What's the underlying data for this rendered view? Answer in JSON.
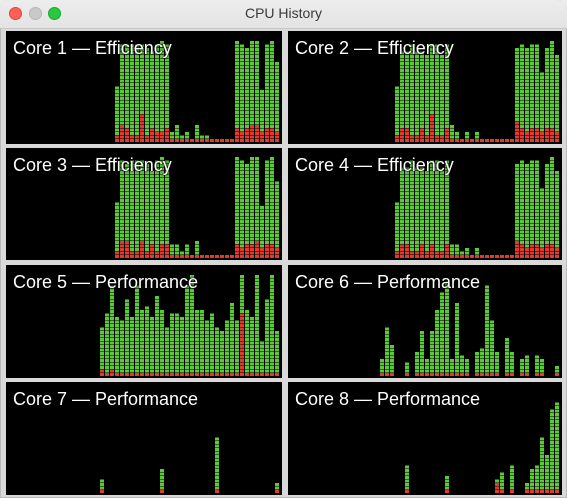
{
  "window": {
    "title": "CPU History"
  },
  "colors": {
    "user": "#5cc93d",
    "system": "#e03b2e",
    "background": "#000000",
    "block_edge": "#2e7a1f"
  },
  "cores": [
    {
      "label": "Core 1 — Efficiency",
      "usage": [
        0,
        0,
        0,
        0,
        0,
        0,
        0,
        0,
        0,
        0,
        0,
        0,
        0,
        0,
        0,
        0,
        0,
        0,
        0,
        0.53,
        0.93,
        0.93,
        0.93,
        0.93,
        0.93,
        0.9,
        0.87,
        0.93,
        0.97,
        0.93,
        0.1,
        0.17,
        0.07,
        0.1,
        0.03,
        0.17,
        0.07,
        0.07,
        0.03,
        0.03,
        0.03,
        0.03,
        0.03,
        0.97,
        0.93,
        0.9,
        0.97,
        0.97,
        0.5,
        0.93,
        0.97,
        0.77
      ],
      "system": [
        0,
        0,
        0,
        0,
        0,
        0,
        0,
        0,
        0,
        0,
        0,
        0,
        0,
        0,
        0,
        0,
        0,
        0,
        0,
        0.07,
        0.17,
        0.13,
        0.07,
        0.07,
        0.27,
        0.07,
        0.13,
        0.1,
        0.1,
        0.13,
        0.03,
        0.03,
        0.03,
        0.03,
        0.03,
        0.03,
        0.03,
        0.03,
        0.03,
        0.03,
        0.03,
        0.03,
        0.03,
        0.13,
        0.1,
        0.13,
        0.17,
        0.17,
        0.1,
        0.13,
        0.13,
        0.1
      ]
    },
    {
      "label": "Core 2 — Efficiency",
      "usage": [
        0,
        0,
        0,
        0,
        0,
        0,
        0,
        0,
        0,
        0,
        0,
        0,
        0,
        0,
        0,
        0,
        0,
        0,
        0,
        0.53,
        0.87,
        0.87,
        0.93,
        0.87,
        0.87,
        0.83,
        0.93,
        0.93,
        0.83,
        0.93,
        0.17,
        0.1,
        0.03,
        0.1,
        0.03,
        0.1,
        0.03,
        0.03,
        0.03,
        0.03,
        0.03,
        0.03,
        0.03,
        0.9,
        0.93,
        0.9,
        0.93,
        0.93,
        0.67,
        0.9,
        0.97,
        0.83
      ],
      "system": [
        0,
        0,
        0,
        0,
        0,
        0,
        0,
        0,
        0,
        0,
        0,
        0,
        0,
        0,
        0,
        0,
        0,
        0,
        0,
        0.07,
        0.13,
        0.13,
        0.07,
        0.07,
        0.13,
        0.07,
        0.27,
        0.07,
        0.07,
        0.13,
        0.03,
        0.03,
        0.03,
        0.03,
        0.03,
        0.03,
        0.03,
        0.03,
        0.03,
        0.03,
        0.03,
        0.03,
        0.03,
        0.2,
        0.13,
        0.1,
        0.13,
        0.13,
        0.1,
        0.13,
        0.13,
        0.1
      ]
    },
    {
      "label": "Core 3 — Efficiency",
      "usage": [
        0,
        0,
        0,
        0,
        0,
        0,
        0,
        0,
        0,
        0,
        0,
        0,
        0,
        0,
        0,
        0,
        0,
        0,
        0,
        0.53,
        0.93,
        0.9,
        0.93,
        0.93,
        0.93,
        0.9,
        0.83,
        0.93,
        0.97,
        0.93,
        0.13,
        0.13,
        0.07,
        0.13,
        0.03,
        0.17,
        0.03,
        0.03,
        0.03,
        0.03,
        0.03,
        0.03,
        0.03,
        0.97,
        0.93,
        0.9,
        0.97,
        0.97,
        0.5,
        0.93,
        0.97,
        0.73
      ],
      "system": [
        0,
        0,
        0,
        0,
        0,
        0,
        0,
        0,
        0,
        0,
        0,
        0,
        0,
        0,
        0,
        0,
        0,
        0,
        0,
        0.07,
        0.17,
        0.17,
        0.07,
        0.07,
        0.17,
        0.07,
        0.13,
        0.07,
        0.13,
        0.13,
        0.03,
        0.03,
        0.03,
        0.03,
        0.03,
        0.03,
        0.03,
        0.03,
        0.03,
        0.03,
        0.03,
        0.03,
        0.03,
        0.13,
        0.1,
        0.13,
        0.13,
        0.17,
        0.1,
        0.13,
        0.13,
        0.1
      ]
    },
    {
      "label": "Core 4 — Efficiency",
      "usage": [
        0,
        0,
        0,
        0,
        0,
        0,
        0,
        0,
        0,
        0,
        0,
        0,
        0,
        0,
        0,
        0,
        0,
        0,
        0,
        0.53,
        0.87,
        0.87,
        0.93,
        0.87,
        0.87,
        0.83,
        0.93,
        0.93,
        0.83,
        0.93,
        0.13,
        0.13,
        0.07,
        0.1,
        0.03,
        0.1,
        0.03,
        0.03,
        0.03,
        0.03,
        0.03,
        0.03,
        0.03,
        0.9,
        0.93,
        0.9,
        0.93,
        0.93,
        0.67,
        0.9,
        0.97,
        0.83
      ],
      "system": [
        0,
        0,
        0,
        0,
        0,
        0,
        0,
        0,
        0,
        0,
        0,
        0,
        0,
        0,
        0,
        0,
        0,
        0,
        0,
        0.07,
        0.13,
        0.13,
        0.07,
        0.07,
        0.13,
        0.07,
        0.13,
        0.07,
        0.07,
        0.13,
        0.03,
        0.03,
        0.03,
        0.03,
        0.03,
        0.03,
        0.03,
        0.03,
        0.03,
        0.03,
        0.03,
        0.03,
        0.03,
        0.17,
        0.13,
        0.1,
        0.13,
        0.13,
        0.1,
        0.13,
        0.13,
        0.1
      ]
    },
    {
      "label": "Core 5 — Performance",
      "usage": [
        0,
        0,
        0,
        0,
        0,
        0,
        0,
        0,
        0,
        0,
        0,
        0,
        0,
        0,
        0,
        0,
        0,
        0,
        0,
        0.47,
        0.6,
        0.87,
        0.57,
        0.53,
        0.73,
        0.57,
        0.87,
        0.63,
        0.67,
        0.57,
        0.77,
        0.63,
        0.47,
        0.6,
        0.6,
        0.57,
        0.87,
        0.97,
        0.63,
        0.63,
        0.53,
        0.6,
        0.47,
        0.43,
        0.53,
        0.7,
        0.53,
        0.97,
        0.63,
        0.57,
        0.97,
        0.33,
        0.73,
        0.97,
        0.43
      ],
      "system": [
        0,
        0,
        0,
        0,
        0,
        0,
        0,
        0,
        0,
        0,
        0,
        0,
        0,
        0,
        0,
        0,
        0,
        0,
        0,
        0.07,
        0.03,
        0.07,
        0.03,
        0.03,
        0.03,
        0.03,
        0.03,
        0.03,
        0.03,
        0.03,
        0.03,
        0.03,
        0.03,
        0.03,
        0.03,
        0.03,
        0.03,
        0.03,
        0.03,
        0.03,
        0.03,
        0.03,
        0.03,
        0.03,
        0.03,
        0.03,
        0.03,
        0.6,
        0.03,
        0.03,
        0.03,
        0.03,
        0.03,
        0.03,
        0.03
      ]
    },
    {
      "label": "Core 6 — Performance",
      "usage": [
        0,
        0,
        0,
        0,
        0,
        0,
        0,
        0,
        0,
        0,
        0,
        0,
        0,
        0,
        0,
        0,
        0,
        0,
        0,
        0.17,
        0.47,
        0.3,
        0.0,
        0.0,
        0.13,
        0.0,
        0.23,
        0.43,
        0.17,
        0.43,
        0.63,
        0.8,
        0.9,
        0.17,
        0.7,
        0.2,
        0.17,
        0.0,
        0.23,
        0.27,
        0.87,
        0.53,
        0.23,
        0.0,
        0.37,
        0.23,
        0.0,
        0.17,
        0.2,
        0.0,
        0.2,
        0.17,
        0.0,
        0.0,
        0.1
      ],
      "system": [
        0,
        0,
        0,
        0,
        0,
        0,
        0,
        0,
        0,
        0,
        0,
        0,
        0,
        0,
        0,
        0,
        0,
        0,
        0,
        0.03,
        0.03,
        0.03,
        0.0,
        0.0,
        0.03,
        0.0,
        0.03,
        0.03,
        0.03,
        0.03,
        0.03,
        0.03,
        0.03,
        0.03,
        0.03,
        0.03,
        0.03,
        0.0,
        0.03,
        0.03,
        0.03,
        0.03,
        0.03,
        0.0,
        0.03,
        0.03,
        0.0,
        0.03,
        0.03,
        0.0,
        0.03,
        0.03,
        0.0,
        0.0,
        0.03
      ]
    },
    {
      "label": "Core 7 — Performance",
      "usage": [
        0,
        0,
        0,
        0,
        0,
        0,
        0,
        0,
        0,
        0,
        0,
        0,
        0,
        0,
        0,
        0,
        0,
        0,
        0,
        0.13,
        0.0,
        0.0,
        0.0,
        0.0,
        0.0,
        0.0,
        0.0,
        0.0,
        0.0,
        0.0,
        0.0,
        0.23,
        0.0,
        0.0,
        0.0,
        0.0,
        0.0,
        0.0,
        0.0,
        0.0,
        0.0,
        0.0,
        0.53,
        0.0,
        0.0,
        0.0,
        0.0,
        0.0,
        0.0,
        0.0,
        0.0,
        0.0,
        0.0,
        0.0,
        0.1
      ],
      "system": [
        0,
        0,
        0,
        0,
        0,
        0,
        0,
        0,
        0,
        0,
        0,
        0,
        0,
        0,
        0,
        0,
        0,
        0,
        0,
        0.03,
        0.0,
        0.0,
        0.0,
        0.0,
        0.0,
        0.0,
        0.0,
        0.0,
        0.0,
        0.0,
        0.0,
        0.03,
        0.0,
        0.0,
        0.0,
        0.0,
        0.0,
        0.0,
        0.0,
        0.0,
        0.0,
        0.0,
        0.03,
        0.0,
        0.0,
        0.0,
        0.0,
        0.0,
        0.0,
        0.0,
        0.0,
        0.0,
        0.0,
        0.0,
        0.03
      ]
    },
    {
      "label": "Core 8 — Performance",
      "usage": [
        0,
        0,
        0,
        0,
        0,
        0,
        0,
        0,
        0,
        0,
        0,
        0,
        0,
        0,
        0,
        0,
        0,
        0,
        0,
        0.0,
        0.0,
        0.0,
        0.0,
        0.0,
        0.0,
        0.0,
        0.0,
        0.0,
        0.0,
        0.27,
        0.0,
        0.0,
        0.0,
        0.0,
        0.0,
        0.0,
        0.0,
        0.17,
        0.0,
        0.0,
        0.0,
        0.0,
        0.0,
        0.0,
        0.0,
        0.0,
        0.0,
        0.13,
        0.2,
        0.0,
        0.27,
        0.0,
        0.0,
        0.1,
        0.23,
        0.27,
        0.53,
        0.37,
        0.8,
        0.87
      ],
      "system": [
        0,
        0,
        0,
        0,
        0,
        0,
        0,
        0,
        0,
        0,
        0,
        0,
        0,
        0,
        0,
        0,
        0,
        0,
        0,
        0.0,
        0.0,
        0.0,
        0.0,
        0.0,
        0.0,
        0.0,
        0.0,
        0.0,
        0.0,
        0.03,
        0.0,
        0.0,
        0.0,
        0.0,
        0.0,
        0.0,
        0.0,
        0.03,
        0.0,
        0.0,
        0.0,
        0.0,
        0.0,
        0.0,
        0.0,
        0.0,
        0.0,
        0.1,
        0.03,
        0.0,
        0.03,
        0.0,
        0.0,
        0.03,
        0.03,
        0.03,
        0.03,
        0.03,
        0.03,
        0.03
      ]
    }
  ]
}
